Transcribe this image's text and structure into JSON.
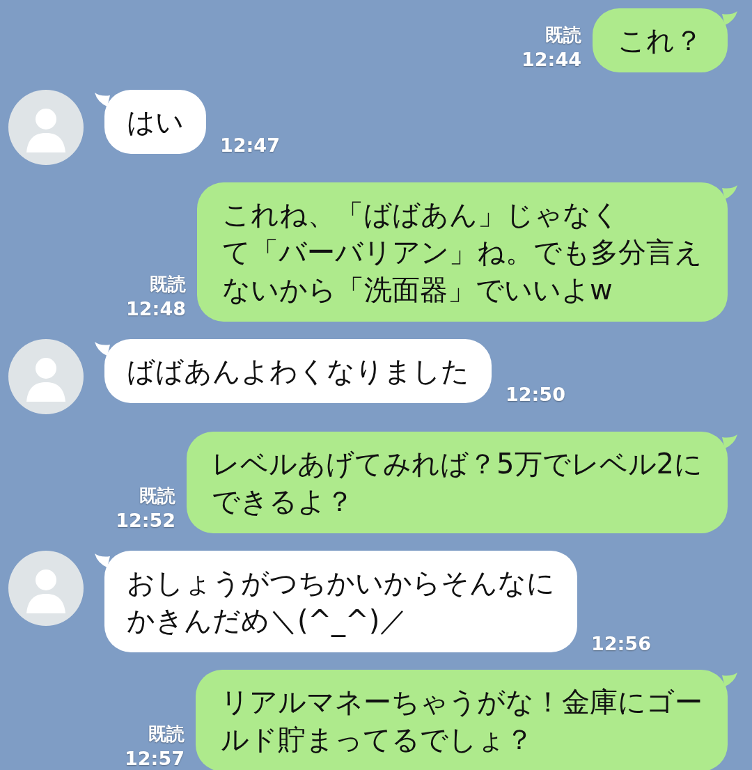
{
  "messages": [
    {
      "kind": "sent",
      "lines": [
        "これ？"
      ],
      "read": "既読",
      "time": "12:44"
    },
    {
      "kind": "received",
      "lines": [
        "はい"
      ],
      "time": "12:47"
    },
    {
      "kind": "sent",
      "lines": [
        "これね、「ばばあん」じゃなく",
        "て「バーバリアン」ね。でも多分言え",
        "ないから「洗面器」でいいよw"
      ],
      "read": "既読",
      "time": "12:48"
    },
    {
      "kind": "received",
      "lines": [
        "ばばあんよわくなりました"
      ],
      "time": "12:50"
    },
    {
      "kind": "sent",
      "lines": [
        "レベルあげてみれば？5万でレベル2に",
        "できるよ？"
      ],
      "read": "既読",
      "time": "12:52"
    },
    {
      "kind": "received",
      "lines": [
        "おしょうがつちかいからそんなに",
        "かきんだめ＼(^_^)／"
      ],
      "time": "12:56"
    },
    {
      "kind": "sent",
      "lines": [
        "リアルマネーちゃうがな！金庫にゴー",
        "ルド貯まってるでしょ？"
      ],
      "read": "既読",
      "time": "12:57"
    }
  ]
}
